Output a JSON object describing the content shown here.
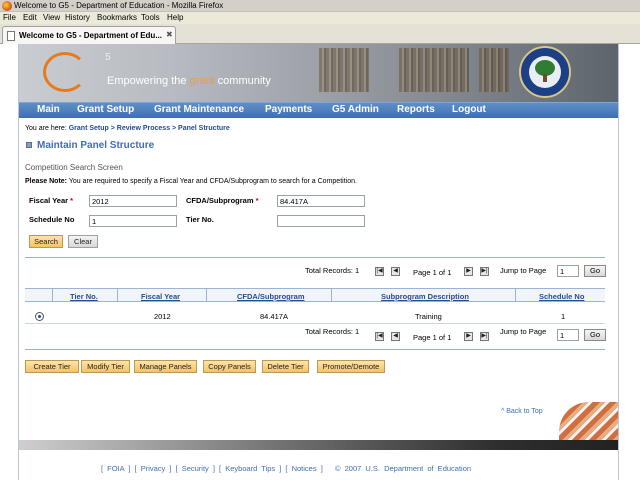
{
  "window": {
    "title": "Welcome to G5 - Department of Education - Mozilla Firefox",
    "menus": [
      "File",
      "Edit",
      "View",
      "History",
      "Bookmarks",
      "Tools",
      "Help"
    ],
    "tab_label": "Welcome to G5 - Department of Edu...",
    "tab_close": "✖"
  },
  "banner": {
    "logo_superscript": "5",
    "tagline_prefix": "Empowering the ",
    "tagline_highlight": "grant",
    "tagline_suffix": " community"
  },
  "nav": [
    "Main",
    "Grant Setup",
    "Grant Maintenance",
    "Payments",
    "G5 Admin",
    "Reports",
    "Logout"
  ],
  "breadcrumb": {
    "prefix": "You are here:",
    "path": "Grant Setup > Review Process > Panel Structure"
  },
  "page_title": "Maintain Panel Structure",
  "subtitle": "Competition Search Screen",
  "note": {
    "label": "Please Note:",
    "text": "You are required to specify a Fiscal Year and CFDA/Subprogram to search for a Competition."
  },
  "form": {
    "required_mark": "*",
    "fiscal_year": {
      "label": "Fiscal Year",
      "value": "2012"
    },
    "cfda": {
      "label": "CFDA/Subprogram",
      "value": "84.417A"
    },
    "schedule": {
      "label": "Schedule No",
      "value": "1"
    },
    "tier": {
      "label": "Tier No.",
      "value": ""
    },
    "search_btn": "Search",
    "clear_btn": "Clear"
  },
  "pager": {
    "total": "Total Records: 1",
    "page_info": "Page 1 of 1",
    "jump_label": "Jump to Page",
    "jump_value": "1",
    "go": "Go",
    "first": "|◀",
    "prev": "◀",
    "next": "▶",
    "last": "▶|"
  },
  "table": {
    "headers": [
      "Tier No.",
      "Fiscal Year",
      "CFDA/Subprogram",
      "Subprogram Description",
      "Schedule No"
    ],
    "rows": [
      {
        "tier": "",
        "year": "2012",
        "cfda": "84.417A",
        "description": "Training",
        "schedule": "1"
      }
    ]
  },
  "actions": [
    "Create Tier",
    "Modify Tier",
    "Manage Panels",
    "Copy Panels",
    "Delete Tier",
    "Promote/Demote"
  ],
  "back_to_top": "^ Back to Top",
  "footer": {
    "links": [
      "FOIA",
      "Privacy",
      "Security",
      "Keyboard Tips",
      "Notices"
    ],
    "copyright": "© 2007 U.S. Department of Education"
  },
  "colors": {
    "nav_blue": "#3f6fb0",
    "link_blue": "#224d92",
    "button_orange": "#f7c363",
    "required_red": "#cc0000",
    "logo_orange": "#e87a1e"
  }
}
